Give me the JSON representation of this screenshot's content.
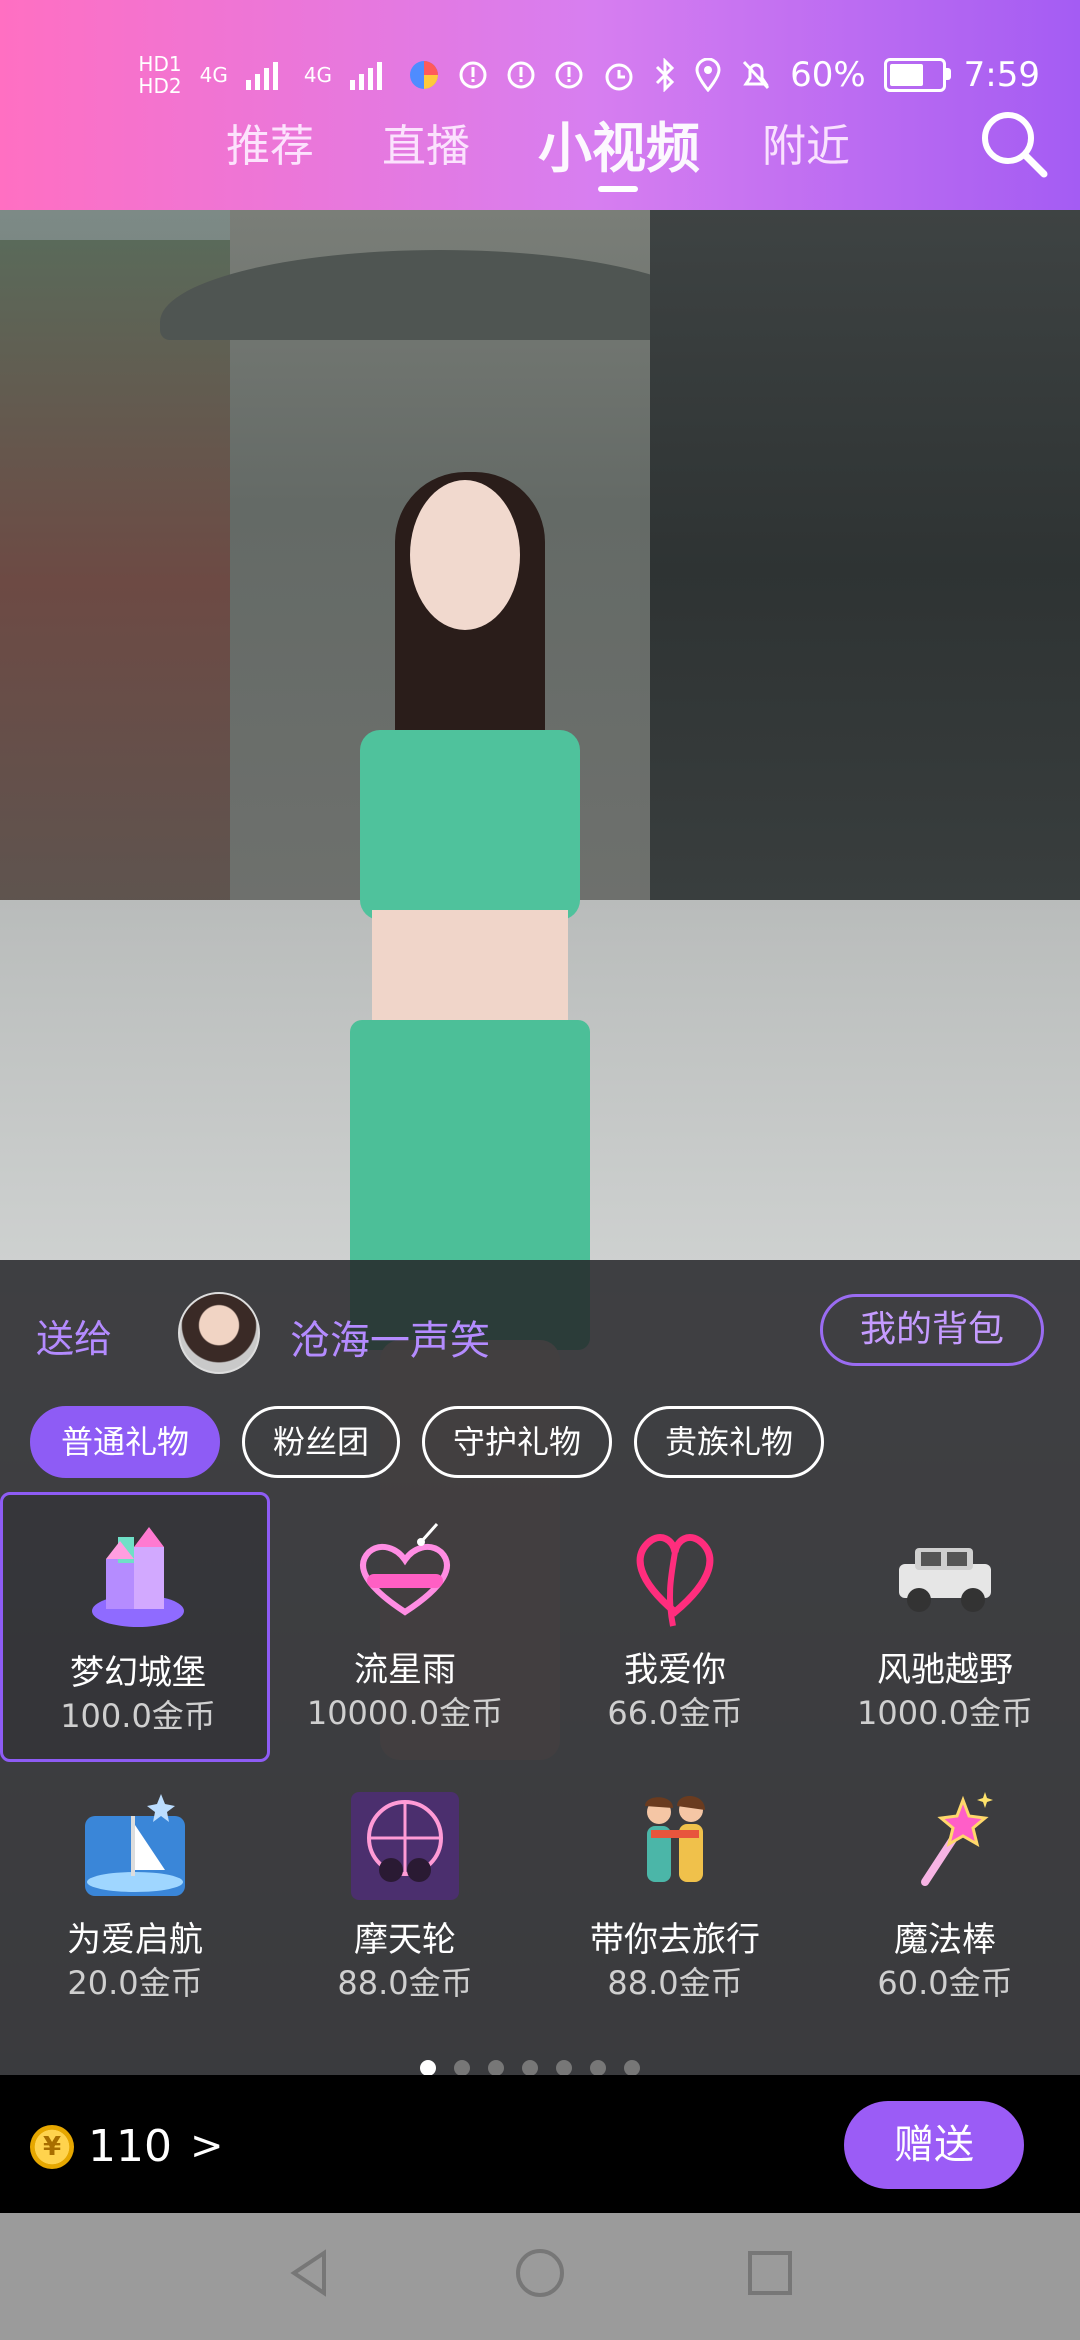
{
  "status_bar": {
    "hd1": "HD1",
    "hd2": "HD2",
    "net1": "4G",
    "net2": "4G",
    "battery_percent": "60%",
    "battery_level": 0.6,
    "time": "7:59"
  },
  "tabs": [
    {
      "label": "推荐",
      "active": false
    },
    {
      "label": "直播",
      "active": false
    },
    {
      "label": "小视频",
      "active": true
    },
    {
      "label": "附近",
      "active": false
    }
  ],
  "gift_panel": {
    "send_to_label": "送给",
    "recipient_name": "沧海一声笑",
    "backpack_label": "我的背包",
    "categories": [
      {
        "label": "普通礼物",
        "active": true
      },
      {
        "label": "粉丝团",
        "active": false
      },
      {
        "label": "守护礼物",
        "active": false
      },
      {
        "label": "贵族礼物",
        "active": false
      }
    ],
    "gifts": [
      {
        "name": "梦幻城堡",
        "price": "100.0金币",
        "icon": "castle-icon",
        "selected": true
      },
      {
        "name": "流星雨",
        "price": "10000.0金币",
        "icon": "meteor-shower-icon",
        "selected": false
      },
      {
        "name": "我爱你",
        "price": "66.0金币",
        "icon": "heart-i-love-you-icon",
        "selected": false
      },
      {
        "name": "风驰越野",
        "price": "1000.0金币",
        "icon": "offroad-car-icon",
        "selected": false
      },
      {
        "name": "为爱启航",
        "price": "20.0金币",
        "icon": "sail-for-love-icon",
        "selected": false
      },
      {
        "name": "摩天轮",
        "price": "88.0金币",
        "icon": "ferris-wheel-icon",
        "selected": false
      },
      {
        "name": "带你去旅行",
        "price": "88.0金币",
        "icon": "travel-couple-icon",
        "selected": false
      },
      {
        "name": "魔法棒",
        "price": "60.0金币",
        "icon": "magic-wand-icon",
        "selected": false
      }
    ],
    "page_count": 7,
    "current_page": 1
  },
  "bottom_bar": {
    "coin_symbol": "¥",
    "balance": "110",
    "balance_arrow": ">",
    "send_label": "赠送"
  },
  "colors": {
    "accent": "#8e5cf5",
    "header_start": "#ff6fc2",
    "header_end": "#a45cf3"
  }
}
